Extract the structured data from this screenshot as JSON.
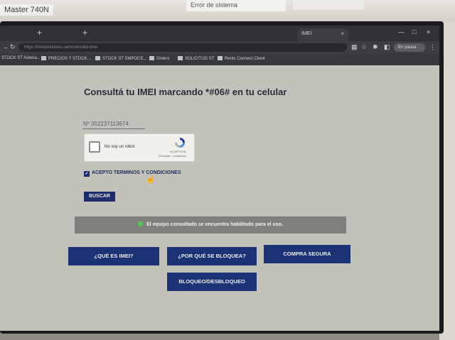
{
  "physical": {
    "sticker_text": "Master 740N",
    "note_text": "Error de sistema"
  },
  "browser": {
    "tab_title": "IMEI",
    "tab_close": "×",
    "window_controls": [
      "—",
      "□",
      "×"
    ],
    "url": "https://imeicelulares.com/consulta-imei",
    "profile_label": "En pausa",
    "bookmarks": [
      "STOCK ST Asteria...",
      "PRECIOS Y STOCK...",
      "STOCK ST SMPOCE...",
      "Orders",
      "SOLICITUD ST",
      "Rents Connect Client"
    ]
  },
  "page": {
    "heading": "Consultá tu IMEI marcando *#06# en tu celular",
    "imei_value": "Nº 352237113674",
    "captcha": {
      "label": "No soy un robot",
      "brand": "reCAPTCHA",
      "links": "Privacidad - Condiciones"
    },
    "terms_label": "ACEPTO TERMINOS Y CONDICIONES",
    "terms_checked": true,
    "search_button": "BUSCAR",
    "status_message": "El equipo consultado se encuentra habilitado para el uso.",
    "status_color": "#5cc35c",
    "buttons": {
      "what_is_imei": "¿QUÉ ES IMEI?",
      "why_blocked": "¿POR QUÉ SE BLOQUEA?",
      "safe_purchase": "COMPRA SEGURA",
      "block_unblock": "BLOQUEO/DESBLOQUEO"
    }
  }
}
